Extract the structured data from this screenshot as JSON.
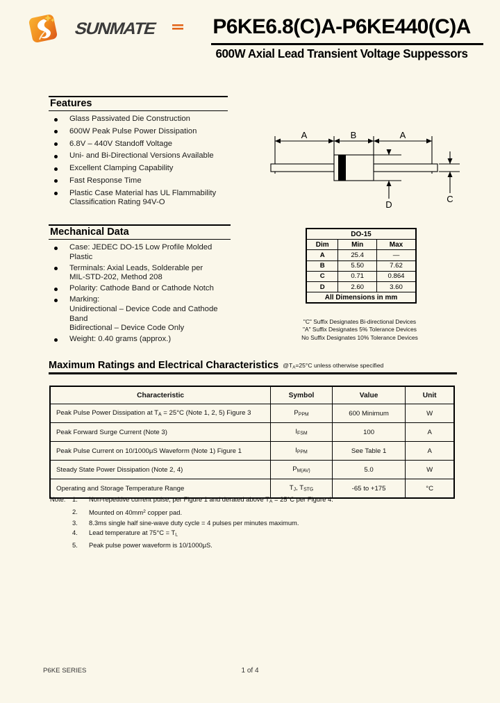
{
  "header": {
    "logo_word": "SUNMATE",
    "logo_icon": "sunmate-flame-logo",
    "part_title": "P6KE6.8(C)A-P6KE440(C)A",
    "sub_title": "600W Axial Lead Transient Voltage Suppessors"
  },
  "features": {
    "heading": "Features",
    "items": [
      {
        "text": "Glass Passivated Die Construction"
      },
      {
        "text": "600W Peak Pulse Power Dissipation"
      },
      {
        "text": "6.8V – 440V Standoff Voltage"
      },
      {
        "text": "Uni- and Bi-Directional Versions Available"
      },
      {
        "text": "Excellent Clamping Capability"
      },
      {
        "text": "Fast Response Time"
      },
      {
        "text": "Plastic Case Material has UL Flammability",
        "line2": "Classification Rating 94V-O"
      }
    ]
  },
  "mechanical": {
    "heading": "Mechanical Data",
    "items": [
      {
        "text": "Case: JEDEC DO-15 Low Profile Molded Plastic"
      },
      {
        "text": "Terminals: Axial Leads, Solderable per",
        "line2": "MIL-STD-202, Method 208"
      },
      {
        "text": "Polarity: Cathode Band or Cathode Notch"
      },
      {
        "text": "Marking:",
        "line2": "Unidirectional – Device Code and Cathode Band",
        "line3": "Bidirectional – Device Code Only"
      },
      {
        "text": "Weight: 0.40 grams (approx.)"
      }
    ]
  },
  "drawing": {
    "labels": {
      "a_left": "A",
      "b": "B",
      "a_right": "A",
      "d": "D",
      "c": "C"
    }
  },
  "dim_table": {
    "title": "DO-15",
    "headers": [
      "Dim",
      "Min",
      "Max"
    ],
    "rows": [
      [
        "A",
        "25.4",
        "—"
      ],
      [
        "B",
        "5.50",
        "7.62"
      ],
      [
        "C",
        "0.71",
        "0.864"
      ],
      [
        "D",
        "2.60",
        "3.60"
      ]
    ],
    "footer": "All Dimensions in mm"
  },
  "suffix_notes": [
    "\"C\" Suffix Designates Bi-directional Devices",
    "\"A\" Suffix Designates 5% Tolerance Devices",
    "No Suffix Designates 10% Tolerance Devices"
  ],
  "max_ratings": {
    "heading": "Maximum Ratings and Electrical Characteristics",
    "condition_prefix": "@T",
    "condition_sub": "A",
    "condition_suffix": "=25°C unless otherwise specified",
    "columns": [
      "Characteristic",
      "Symbol",
      "Value",
      "Unit"
    ],
    "rows": [
      {
        "characteristic_pre": "Peak Pulse Power Dissipation at T",
        "characteristic_sub": "A",
        "characteristic_post": " = 25°C (Note 1, 2, 5) Figure 3",
        "symbol_main": "P",
        "symbol_sub": "PPM",
        "value": "600 Minimum",
        "unit": "W"
      },
      {
        "characteristic_pre": "Peak Forward Surge Current (Note 3)",
        "characteristic_sub": "",
        "characteristic_post": "",
        "symbol_main": "I",
        "symbol_sub": "FSM",
        "value": "100",
        "unit": "A"
      },
      {
        "characteristic_pre": "Peak Pulse Current on 10/1000μS Waveform (Note 1) Figure 1",
        "characteristic_sub": "",
        "characteristic_post": "",
        "symbol_main": "I",
        "symbol_sub": "PPM",
        "value": "See Table 1",
        "unit": "A"
      },
      {
        "characteristic_pre": "Steady State Power Dissipation (Note 2, 4)",
        "characteristic_sub": "",
        "characteristic_post": "",
        "symbol_main": "P",
        "symbol_sub": "M(AV)",
        "value": "5.0",
        "unit": "W"
      },
      {
        "characteristic_pre": "Operating and Storage Temperature Range",
        "characteristic_sub": "",
        "characteristic_post": "",
        "symbol_main": "T",
        "symbol_sub": "J",
        "symbol_main2": ", T",
        "symbol_sub2": "STG",
        "value": "-65 to +175",
        "unit": "°C"
      }
    ]
  },
  "notes": {
    "label": "Note:",
    "items": [
      {
        "num": "1.",
        "pre": "Non-repetitive current pulse, per Figure 1 and derated above T",
        "sub": "A",
        "post": " = 25°C per Figure 4."
      },
      {
        "num": "2.",
        "pre": "Mounted on 40mm",
        "sup": "2",
        "post": " copper pad."
      },
      {
        "num": "3.",
        "pre": "8.3ms single half sine-wave duty cycle = 4 pulses per minutes maximum.",
        "post": ""
      },
      {
        "num": "4.",
        "pre": "Lead temperature at 75°C = T",
        "sub": "L",
        "post": ""
      },
      {
        "num": "5.",
        "pre": "Peak pulse power waveform is 10/1000μS.",
        "post": ""
      }
    ]
  },
  "footer": {
    "series": "P6KE SERIES",
    "page": "1 of 4"
  },
  "colors": {
    "page_bg": "#faf7ea",
    "ink": "#000000",
    "logo_orange": "#f08a1e",
    "logo_orange_dark": "#e2651a",
    "logo_yellow": "#f7c948"
  }
}
